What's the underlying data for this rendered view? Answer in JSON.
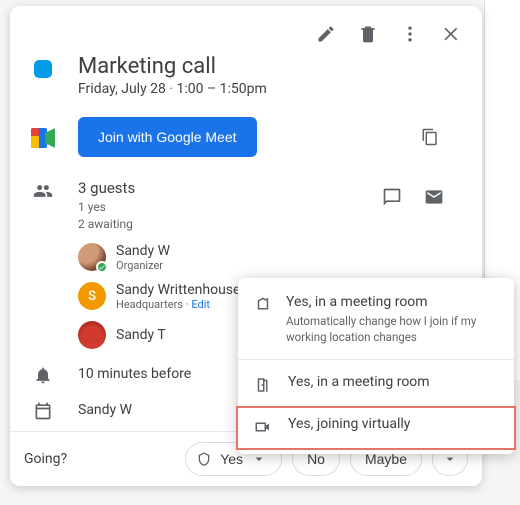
{
  "event": {
    "title": "Marketing call",
    "date": "Friday, July 28",
    "time": "1:00 – 1:50pm",
    "color": "#039be5"
  },
  "meet": {
    "join_label": "Join with Google Meet"
  },
  "guests": {
    "count_label": "3 guests",
    "yes_label": "1 yes",
    "awaiting_label": "2 awaiting",
    "list": [
      {
        "name": "Sandy W",
        "sub": "Organizer",
        "avatar_letter": "",
        "avatar_type": "photo",
        "checked": true
      },
      {
        "name": "Sandy Writtenhouse",
        "sub": "Headquarters",
        "edit": "Edit",
        "avatar_letter": "S",
        "avatar_type": "orange",
        "checked": false
      },
      {
        "name": "Sandy T",
        "sub": "",
        "avatar_letter": "",
        "avatar_type": "red",
        "checked": false
      }
    ]
  },
  "reminder": {
    "label": "10 minutes before"
  },
  "calendar_owner": {
    "label": "Sandy W"
  },
  "rsvp": {
    "question": "Going?",
    "yes": "Yes",
    "no": "No",
    "maybe": "Maybe"
  },
  "popup": {
    "opt1_label": "Yes, in a meeting room",
    "opt1_sub": "Automatically change how I join if my working location changes",
    "opt2_label": "Yes, in a meeting room",
    "opt3_label": "Yes, joining virtually"
  }
}
